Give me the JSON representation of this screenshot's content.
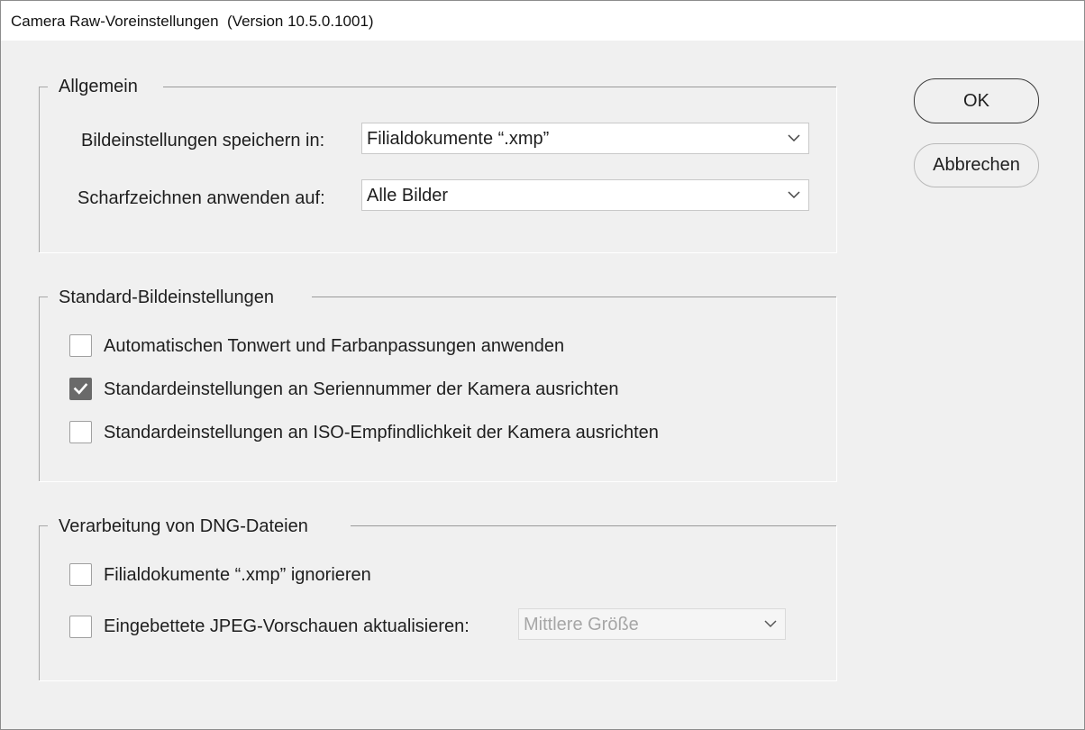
{
  "window": {
    "title": "Camera Raw-Voreinstellungen  (Version 10.5.0.1001)"
  },
  "groups": {
    "general": {
      "label": "Allgemein",
      "save_settings_label": "Bildeinstellungen speichern in:",
      "save_settings_value": "Filialdokumente “.xmp”",
      "sharpen_label": "Scharfzeichnen anwenden auf:",
      "sharpen_value": "Alle Bilder"
    },
    "defaults": {
      "label": "Standard-Bildeinstellungen",
      "options": [
        {
          "label": "Automatischen Tonwert und Farbanpassungen anwenden",
          "checked": false
        },
        {
          "label": "Standardeinstellungen an Seriennummer der Kamera ausrichten",
          "checked": true
        },
        {
          "label": "Standardeinstellungen an ISO-Empfindlichkeit der Kamera ausrichten",
          "checked": false
        }
      ]
    },
    "dng": {
      "label": "Verarbeitung von DNG-Dateien",
      "ignore_sidecar_label": "Filialdokumente “.xmp” ignorieren",
      "ignore_sidecar_checked": false,
      "update_previews_label": "Eingebettete JPEG-Vorschauen aktualisieren:",
      "update_previews_checked": false,
      "preview_size_value": "Mittlere Größe",
      "preview_size_disabled": true
    }
  },
  "buttons": {
    "ok_label": "OK",
    "cancel_label": "Abbrechen"
  },
  "icons": {
    "dropdown": "chevron-down-icon",
    "check": "checkmark-icon"
  }
}
